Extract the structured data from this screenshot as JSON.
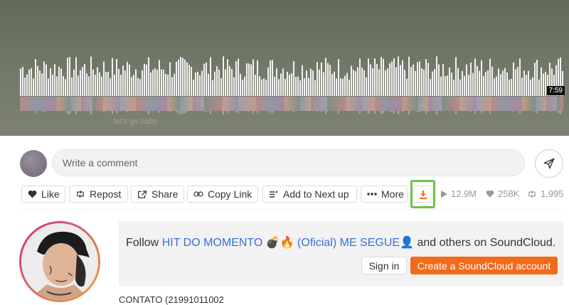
{
  "player": {
    "duration": "7:59",
    "faded_comment": "let's go baby"
  },
  "comment": {
    "placeholder": "Write a comment"
  },
  "actions": {
    "like": "Like",
    "repost": "Repost",
    "share": "Share",
    "copy_link": "Copy Link",
    "add_to_next_up": "Add to Next up",
    "more": "More"
  },
  "stats": {
    "plays": "12.9M",
    "likes": "258K",
    "reposts": "1,995"
  },
  "follow_panel": {
    "prefix": "Follow ",
    "artist": "HIT DO MOMENTO 💣🔥 (Oficial) ME SEGUE👤",
    "suffix": " and others on SoundCloud.",
    "sign_in": "Sign in",
    "create_account": "Create a SoundCloud account"
  },
  "description": {
    "text": "CONTATO (21991011002"
  },
  "colors": {
    "accent_orange": "#f26a1a",
    "highlight_green": "#6ec24a",
    "link_blue": "#3b6fd6",
    "hero_bg": "#6c7260"
  },
  "icons": {
    "like": "heart-icon",
    "repost": "repost-icon",
    "share": "share-icon",
    "copy_link": "link-icon",
    "add_to_next_up": "queue-icon",
    "more": "ellipsis-icon",
    "download": "download-icon",
    "send": "send-icon",
    "plays": "play-icon",
    "likes": "heart-icon",
    "reposts": "repost-icon"
  }
}
